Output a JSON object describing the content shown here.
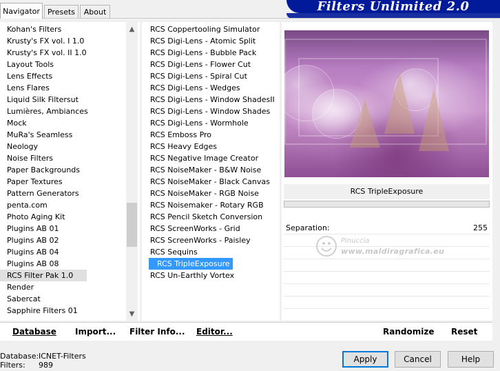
{
  "banner": {
    "title": "Filters Unlimited 2.0"
  },
  "tabs": [
    {
      "label": "Navigator"
    },
    {
      "label": "Presets"
    },
    {
      "label": "About"
    }
  ],
  "categories": {
    "items": [
      "Kohan's Filters",
      "Krusty's FX vol. I 1.0",
      "Krusty's FX vol. II 1.0",
      "Layout Tools",
      "Lens Effects",
      "Lens Flares",
      "Liquid Silk Filtersut",
      "Lumières, Ambiances",
      "Mock",
      "MuRa's Seamless",
      "Neology",
      "Noise Filters",
      "Paper Backgrounds",
      "Paper Textures",
      "Pattern Generators",
      "penta.com",
      "Photo Aging Kit",
      "Plugins AB 01",
      "Plugins AB 02",
      "Plugins AB 04",
      "Plugins AB 08",
      "RCS Filter Pak 1.0",
      "Render",
      "Sabercat",
      "Sapphire Filters 01"
    ],
    "selected": "RCS Filter Pak 1.0"
  },
  "filters": {
    "items": [
      "RCS Coppertooling Simulator",
      "RCS Digi-Lens - Atomic Split",
      "RCS Digi-Lens - Bubble Pack",
      "RCS Digi-Lens - Flower Cut",
      "RCS Digi-Lens - Spiral Cut",
      "RCS Digi-Lens - Wedges",
      "RCS Digi-Lens - Window ShadesII",
      "RCS Digi-Lens - Window Shades",
      "RCS Digi-Lens - Wormhole",
      "RCS Emboss Pro",
      "RCS Heavy Edges",
      "RCS Negative Image Creator",
      "RCS NoiseMaker - B&W Noise",
      "RCS NoiseMaker - Black Canvas",
      "RCS NoiseMaker - RGB Noise",
      "RCS Noisemaker - Rotary RGB",
      "RCS Pencil Sketch Conversion",
      "RCS ScreenWorks - Grid",
      "RCS ScreenWorks - Paisley",
      "RCS Sequins",
      "RCS TripleExposure",
      "RCS Un-Earthly Vortex"
    ],
    "selected": "RCS TripleExposure"
  },
  "preview": {
    "selected_filter_title": "RCS TripleExposure"
  },
  "params": [
    {
      "label": "Separation:",
      "value": "255"
    }
  ],
  "watermark": {
    "name": "Pinuccia",
    "site": "www.maldiragrafica.eu"
  },
  "bottom_buttons": {
    "database": "Database",
    "import": "Import...",
    "filter_info": "Filter Info...",
    "editor": "Editor...",
    "randomize": "Randomize",
    "reset": "Reset"
  },
  "status": {
    "database_label": "Database:",
    "database_value": "ICNET-Filters",
    "filters_label": "Filters:",
    "filters_value": "989"
  },
  "dialog_buttons": {
    "apply": "Apply",
    "cancel": "Cancel",
    "help": "Help"
  },
  "colors": {
    "banner": "#001a99",
    "selection": "#3399ff"
  }
}
